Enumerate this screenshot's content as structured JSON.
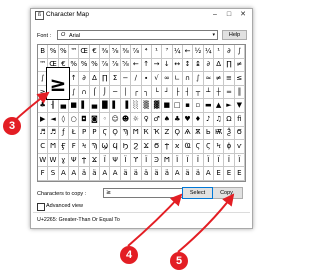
{
  "window": {
    "title": "Character Map",
    "minimize_glyph": "–",
    "maximize_glyph": "□",
    "close_glyph": "✕"
  },
  "font": {
    "label": "Font :",
    "value": "Arial",
    "type_glyph": "O"
  },
  "buttons": {
    "help": "Help",
    "select": "Select",
    "copy": "Copy"
  },
  "grid": {
    "rows": [
      [
        "B",
        "%",
        "%",
        "™",
        "Œ",
        "€",
        "⅜",
        "⅝",
        "⅜",
        "⅞",
        "⁴",
        "¹",
        "⁷",
        "¼",
        "←",
        "½",
        "¼",
        "¹",
        "∂",
        "∫"
      ],
      [
        "™",
        "Œ",
        "€",
        "%",
        "%",
        "%",
        "⅞",
        "⅞",
        "⅝",
        "←",
        "↑",
        "→",
        "↓",
        "↔",
        "↕",
        "↨",
        "∂",
        "∆",
        "∏",
        "≠"
      ],
      [
        "∫",
        "Ω",
        "↕",
        "↑",
        "∂",
        "∆",
        "∏",
        "Σ",
        "−",
        "∕",
        "∙",
        "√",
        "∞",
        "∟",
        "∩",
        "∫",
        "≈",
        "≠",
        "≡",
        "≤"
      ],
      [
        "≥",
        "⌂",
        "≤",
        "∫",
        "∩",
        "⌠",
        "⌡",
        "─",
        "│",
        "┌",
        "┐",
        "└",
        "┘",
        "├",
        "┤",
        "┬",
        "┴",
        "┼",
        "═",
        "║"
      ],
      [
        "♣",
        "╢",
        "▄",
        "■",
        "▌",
        "▄",
        "█",
        "▌",
        "▐",
        "░",
        "▒",
        "▓",
        "■",
        "□",
        "▪",
        "▫",
        "▬",
        "▲",
        "►",
        "▼"
      ],
      [
        "▶",
        "◄",
        "◊",
        "○",
        "◘",
        "◙",
        "◦",
        "☺",
        "☻",
        "☼",
        "♀",
        "♂",
        "♠",
        "♣",
        "♥",
        "♦",
        "♪",
        "♫",
        "Ω",
        "ﬁ"
      ],
      [
        "♬",
        "♬",
        "ƒ",
        "Ł",
        "Ρ",
        "Ρ",
        "Ϛ",
        "Ϙ",
        "Ϡ",
        "Ϻ",
        "Ҟ",
        "Ҡ",
        "Ζ",
        "Ϙ",
        "Ѧ",
        "Ѫ",
        "Ь",
        "Ѭ",
        "Ѯ",
        "Ϭ"
      ],
      [
        "Ϲ",
        "Ϻ",
        "Ӻ",
        "Ϝ",
        "Ϟ",
        "Ϡ",
        "Ϣ",
        "Ϥ",
        "Ϧ",
        "Ϩ",
        "Ϫ",
        "Ϭ",
        "Ϯ",
        "ϰ",
        "Ҩ",
        "Ϛ",
        "Ϛ",
        "Ϟ",
        "ϕ",
        "ѵ"
      ],
      [
        "W",
        "W",
        "ɣ",
        "Ψ",
        "Ϯ",
        "Ϫ",
        "Ϊ",
        "Ψ",
        "Ϊ",
        "ϒ",
        "Ϊ",
        "Ͽ",
        "Ϻ",
        "Ϊ",
        "Ϊ",
        "Ϊ",
        "Ϊ",
        "Ϊ",
        "Ϊ",
        "Ϊ"
      ],
      [
        "F",
        "S",
        "A",
        "A",
        "ä",
        "ä",
        "A",
        "A",
        "ä",
        "ä",
        "ä",
        "ä",
        "ä",
        "A",
        "ä",
        "ä",
        "A",
        "E",
        "E",
        "E"
      ]
    ]
  },
  "zoom_glyph": "≥",
  "copy_field": {
    "label": "Characters to copy :",
    "value": "≥"
  },
  "advanced_view_label": "Advanced view",
  "status_text": "U+2265: Greater-Than Or Equal To",
  "callouts": {
    "zoom": "3",
    "select": "4",
    "copy": "5"
  },
  "colors": {
    "callout_red": "#e31e24",
    "select_button_border": "#0078d7"
  }
}
